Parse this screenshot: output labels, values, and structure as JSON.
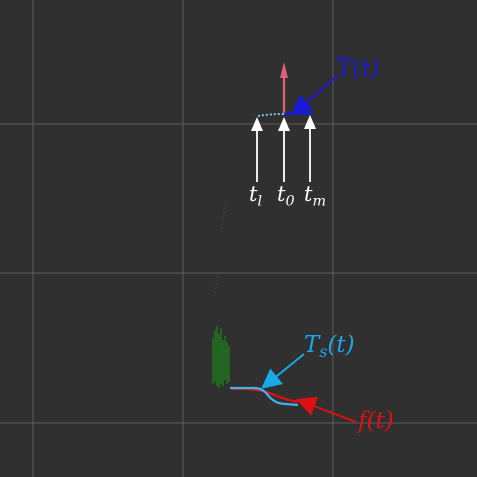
{
  "scene": {
    "background": "#303030",
    "grid_color": "#6e6e6e"
  },
  "labels": {
    "t_l": {
      "base": "t",
      "sub": "l"
    },
    "t_0": {
      "base": "t",
      "sub": "0"
    },
    "t_m": {
      "base": "t",
      "sub": "m"
    },
    "that": {
      "base": "T",
      "arg": "(t)",
      "color": "#1a1adc"
    },
    "ts": {
      "base": "T",
      "sub": "s",
      "arg": "(t)",
      "color": "#1aa8e6"
    },
    "ft": {
      "text": "f(t)",
      "color": "#e01010"
    }
  },
  "colors": {
    "axis_arrow": "#e0607a",
    "tangent_arrow": "#1a1adc",
    "marker_arrows": "#ffffff",
    "ts_curve": "#3ab4f0",
    "f_curve": "#e01010",
    "vertical_lines": "#1a6e1a"
  }
}
